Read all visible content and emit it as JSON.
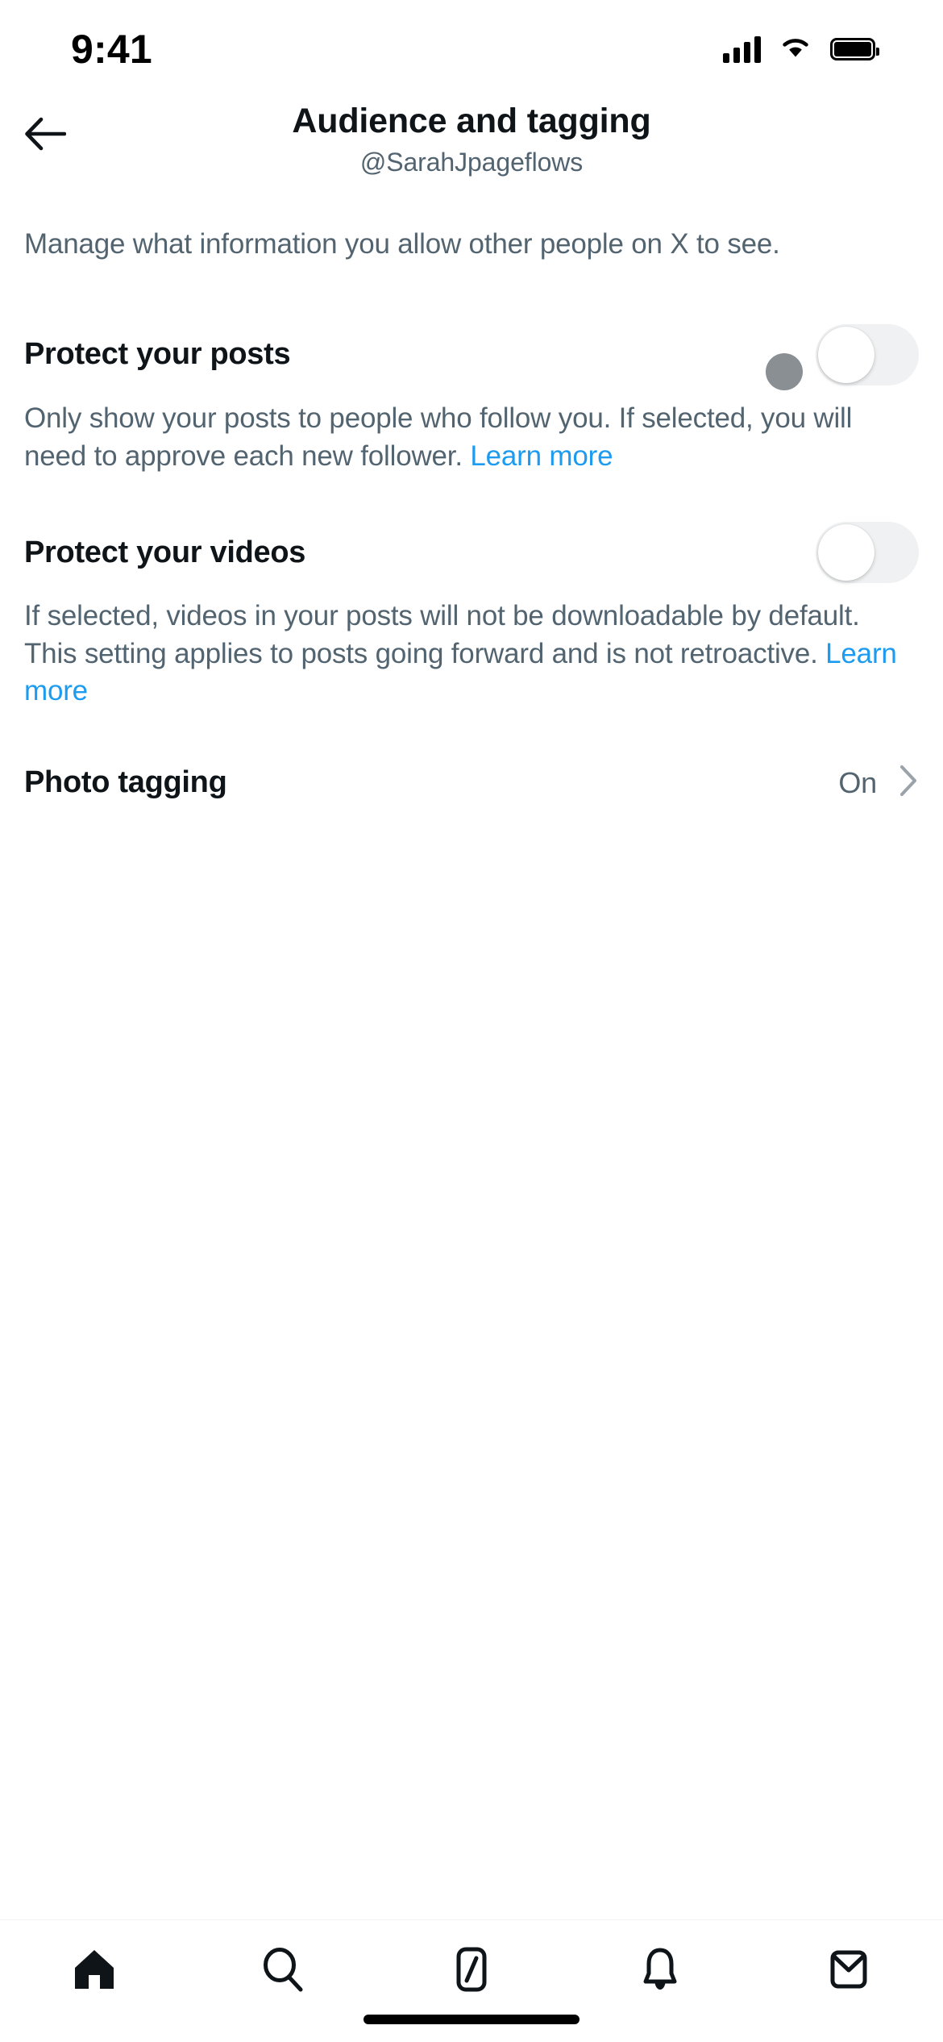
{
  "status_bar": {
    "time": "9:41",
    "signal_icon": "cellular-bars-icon",
    "wifi_icon": "wifi-icon",
    "battery_icon": "battery-icon"
  },
  "header": {
    "back_icon": "back-arrow-icon",
    "title": "Audience and tagging",
    "subtitle": "@SarahJpageflows"
  },
  "intro": {
    "text": "Manage what information you allow other people on X to see."
  },
  "settings": [
    {
      "id": "protect-your-posts",
      "title": "Protect your posts",
      "description": "Only show your posts to people who follow you. If selected, you will need to approve each new follower. ",
      "link_label": "Learn more",
      "toggle_state": "off"
    },
    {
      "id": "protect-your-videos",
      "title": "Protect your videos",
      "description": "If selected, videos in your posts will not be downloadable by default. This setting applies to posts going forward and is not retroactive. ",
      "link_label": "Learn more",
      "toggle_state": "off"
    }
  ],
  "photo_tagging": {
    "title": "Photo tagging",
    "value": "On",
    "chevron_icon": "chevron-right-icon"
  },
  "tab_bar": {
    "items": [
      {
        "name": "home",
        "icon": "home-icon",
        "selected": true
      },
      {
        "name": "search",
        "icon": "search-icon",
        "selected": false
      },
      {
        "name": "grok",
        "icon": "grok-slash-icon",
        "selected": false
      },
      {
        "name": "notifications",
        "icon": "bell-icon",
        "selected": false
      },
      {
        "name": "messages",
        "icon": "envelope-icon",
        "selected": false
      }
    ]
  },
  "colors": {
    "text_primary": "#0f1419",
    "text_secondary": "#536471",
    "link": "#1d9bf0",
    "toggle_track_off": "#eff1f2",
    "cursor": "#8a8f94"
  }
}
